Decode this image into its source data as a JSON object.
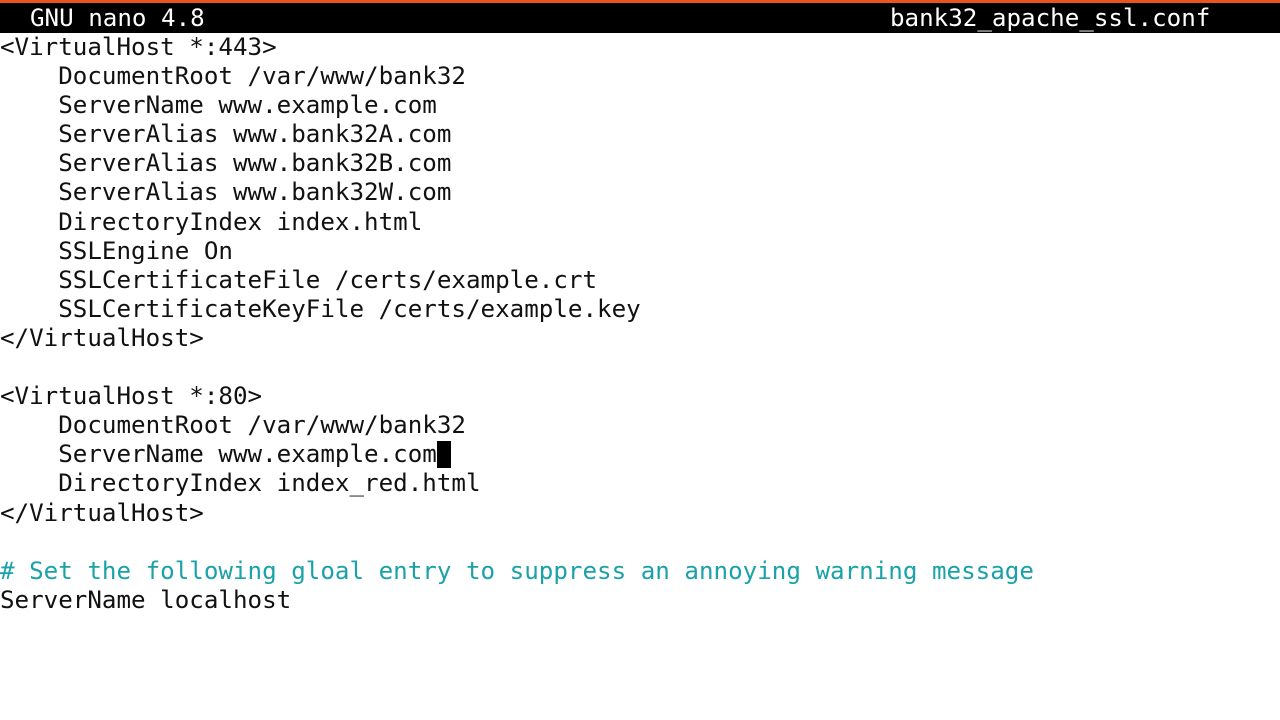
{
  "titlebar": {
    "app_name": "GNU nano 4.8",
    "file_name": "bank32_apache_ssl.conf"
  },
  "accent_color": "#e95420",
  "comment_color": "#1aa2a8",
  "editor": {
    "lines": [
      "<VirtualHost *:443>",
      "    DocumentRoot /var/www/bank32",
      "    ServerName www.example.com",
      "    ServerAlias www.bank32A.com",
      "    ServerAlias www.bank32B.com",
      "    ServerAlias www.bank32W.com",
      "    DirectoryIndex index.html",
      "    SSLEngine On",
      "    SSLCertificateFile /certs/example.crt",
      "    SSLCertificateKeyFile /certs/example.key",
      "</VirtualHost>",
      "",
      "<VirtualHost *:80>",
      "    DocumentRoot /var/www/bank32",
      "    ServerName www.example.com",
      "    DirectoryIndex index_red.html",
      "</VirtualHost>",
      "",
      "# Set the following gloal entry to suppress an annoying warning message",
      "ServerName localhost"
    ]
  }
}
